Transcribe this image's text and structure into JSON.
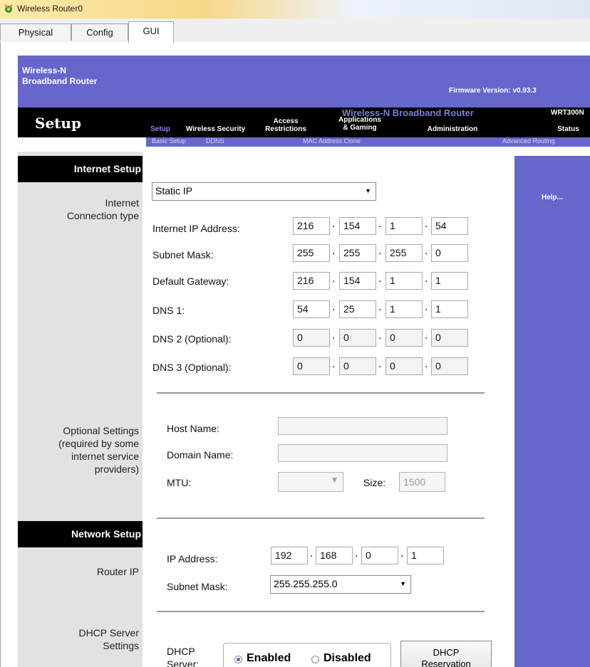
{
  "window": {
    "title": "Wireless Router0"
  },
  "tabs": [
    {
      "label": "Physical",
      "active": false
    },
    {
      "label": "Config",
      "active": false
    },
    {
      "label": "GUI",
      "active": true
    }
  ],
  "header": {
    "brand_line1": "Wireless-N",
    "brand_line2": "Broadband Router",
    "firmware": "Firmware Version: v0.93.3",
    "section_title": "Setup",
    "product_name": "Wireless-N Broadband Router",
    "model": "WRT300N",
    "nav": [
      {
        "label": "Setup"
      },
      {
        "label": "Wireless Security"
      },
      {
        "label_line1": "Access",
        "label_line2": "Restrictions"
      },
      {
        "label_line1": "Applications",
        "label_line2": "& Gaming"
      },
      {
        "label": "Administration"
      },
      {
        "label": "Status"
      }
    ],
    "subnav": [
      "Basic Setup",
      "DDNS",
      "MAC Address Clone",
      "Advanced Routing"
    ]
  },
  "help": {
    "label": "Help..."
  },
  "internet_setup": {
    "heading": "Internet Setup",
    "connection_label_line1": "Internet",
    "connection_label_line2": "Connection type",
    "connection_type": "Static IP",
    "fields": [
      {
        "label": "Internet IP Address:",
        "octets": [
          "216",
          "154",
          "1",
          "54"
        ],
        "enabled": true
      },
      {
        "label": "Subnet Mask:",
        "octets": [
          "255",
          "255",
          "255",
          "0"
        ],
        "enabled": true
      },
      {
        "label": "Default Gateway:",
        "octets": [
          "216",
          "154",
          "1",
          "1"
        ],
        "enabled": true
      },
      {
        "label": "DNS 1:",
        "octets": [
          "54",
          "25",
          "1",
          "1"
        ],
        "enabled": true
      },
      {
        "label": "DNS 2 (Optional):",
        "octets": [
          "0",
          "0",
          "0",
          "0"
        ],
        "enabled": false
      },
      {
        "label": "DNS 3 (Optional):",
        "octets": [
          "0",
          "0",
          "0",
          "0"
        ],
        "enabled": false
      }
    ]
  },
  "optional": {
    "label_line1": "Optional Settings",
    "label_line2": "(required by some",
    "label_line3": "internet service",
    "label_line4": "providers)",
    "host_name_label": "Host Name:",
    "host_name": "",
    "domain_name_label": "Domain Name:",
    "domain_name": "",
    "mtu_label": "MTU:",
    "mtu_value": "",
    "size_label": "Size:",
    "size_value": "1500"
  },
  "network_setup": {
    "heading": "Network Setup",
    "router_ip_label": "Router IP",
    "ip_label": "IP Address:",
    "ip_octets": [
      "192",
      "168",
      "0",
      "1"
    ],
    "mask_label": "Subnet Mask:",
    "mask_value": "255.255.255.0",
    "dhcp_label_line1": "DHCP Server",
    "dhcp_label_line2": "Settings",
    "dhcp_server_line1": "DHCP",
    "dhcp_server_line2": "Server:",
    "enabled_label": "Enabled",
    "disabled_label": "Disabled",
    "dhcp_selected": "Enabled",
    "reservation_line1": "DHCP",
    "reservation_line2": "Reservation"
  }
}
